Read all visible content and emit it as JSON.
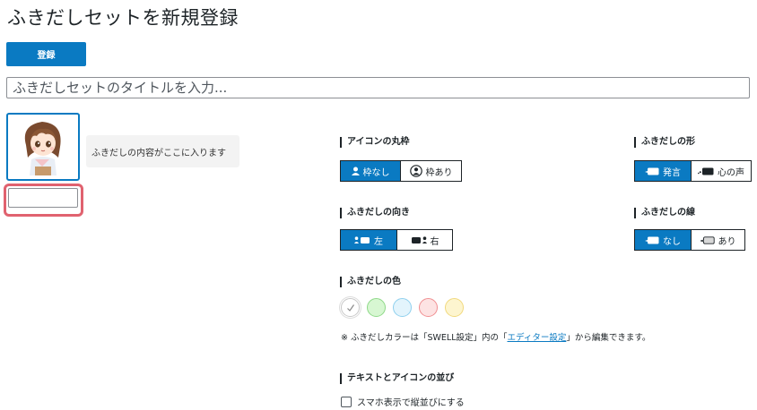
{
  "page": {
    "title": "ふきだしセットを新規登録"
  },
  "actions": {
    "register_label": "登録"
  },
  "title_input": {
    "placeholder": "ふきだしセットのタイトルを入力...",
    "value": ""
  },
  "preview": {
    "bubble_text": "ふきだしの内容がここに入ります",
    "name_value": ""
  },
  "icon_frame": {
    "label": "アイコンの丸枠",
    "options": [
      {
        "label": "枠なし",
        "icon": "person-icon",
        "selected": true
      },
      {
        "label": "枠あり",
        "icon": "person-circle-icon",
        "selected": false
      }
    ]
  },
  "direction": {
    "label": "ふきだしの向き",
    "options": [
      {
        "label": "左",
        "icon": "person-bubble-left-icon",
        "selected": true
      },
      {
        "label": "右",
        "icon": "bubble-person-right-icon",
        "selected": false
      }
    ]
  },
  "shape": {
    "label": "ふきだしの形",
    "options": [
      {
        "label": "発言",
        "icon": "speech-bubble-icon",
        "selected": true
      },
      {
        "label": "心の声",
        "icon": "thought-bubble-icon",
        "selected": false
      }
    ]
  },
  "border": {
    "label": "ふきだしの線",
    "options": [
      {
        "label": "なし",
        "icon": "bubble-no-border-icon",
        "selected": true
      },
      {
        "label": "あり",
        "icon": "bubble-border-icon",
        "selected": false
      }
    ]
  },
  "color": {
    "label": "ふきだしの色",
    "swatches": [
      {
        "name": "default",
        "fill": "#ffffff",
        "stroke": "#c8c8c8",
        "selected": true
      },
      {
        "name": "green",
        "fill": "#d7f7d2",
        "stroke": "#8fd989",
        "selected": false
      },
      {
        "name": "blue",
        "fill": "#e3f4fc",
        "stroke": "#8fd0ee",
        "selected": false
      },
      {
        "name": "red",
        "fill": "#fde3e3",
        "stroke": "#f08f92",
        "selected": false
      },
      {
        "name": "yellow",
        "fill": "#fdf5cf",
        "stroke": "#f1d97e",
        "selected": false
      }
    ],
    "note_prefix": "※ ふきだしカラーは「SWELL設定」内の「",
    "note_link": "エディター設定",
    "note_suffix": "」から編集できます。"
  },
  "layout": {
    "label": "テキストとアイコンの並び",
    "checkbox_label": "スマホ表示で縦並びにする",
    "checked": false
  },
  "colors": {
    "accent": "#0a7ac2",
    "highlight": "#e0626f"
  }
}
